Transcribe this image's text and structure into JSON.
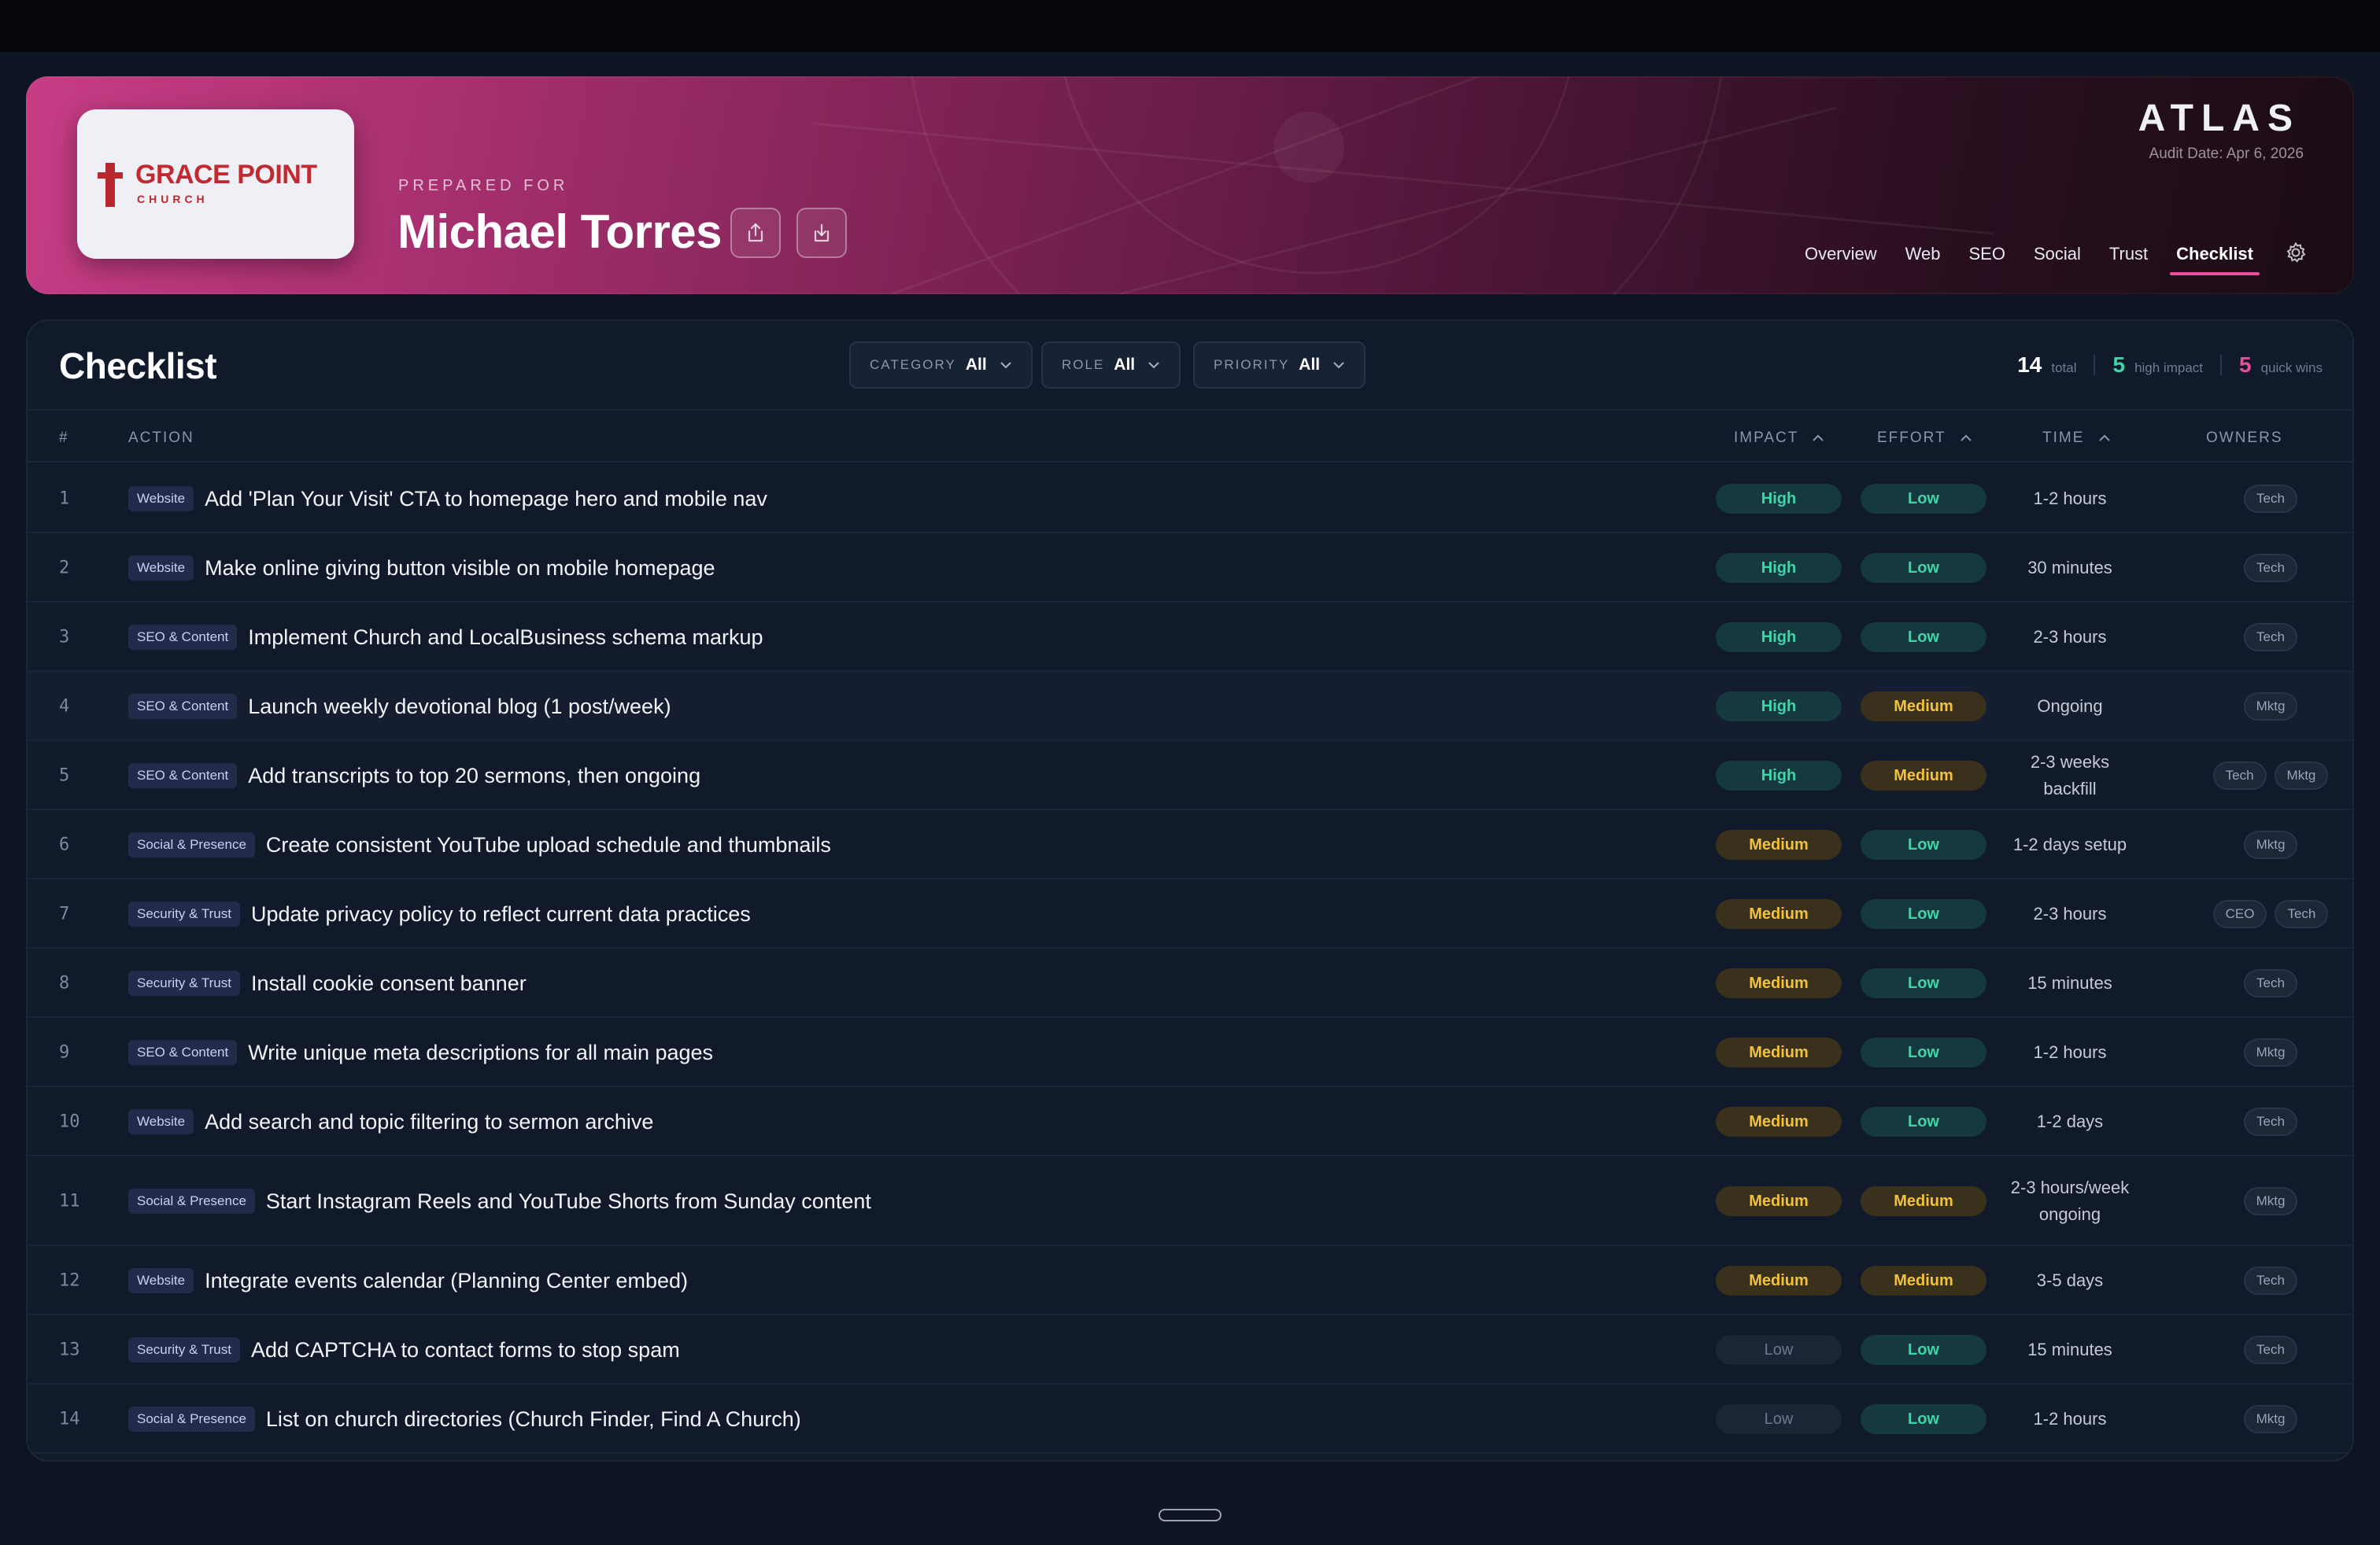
{
  "header": {
    "logo": {
      "name": "GRACE POINT",
      "sub": "CHURCH"
    },
    "prepared_label": "PREPARED FOR",
    "client_name": "Michael Torres",
    "brand": "ATLAS",
    "audit_date": "Audit Date: Apr 6, 2026",
    "nav": [
      "Overview",
      "Web",
      "SEO",
      "Social",
      "Trust",
      "Checklist"
    ],
    "active_tab": "Checklist"
  },
  "checklist": {
    "title": "Checklist",
    "filters": [
      {
        "label": "CATEGORY",
        "value": "All"
      },
      {
        "label": "ROLE",
        "value": "All"
      },
      {
        "label": "PRIORITY",
        "value": "All"
      }
    ],
    "stats": {
      "total": {
        "value": "14",
        "label": "total",
        "color": "#ffffff"
      },
      "high_impact": {
        "value": "5",
        "label": "high impact",
        "color": "#3ed6a7"
      },
      "quick_wins": {
        "value": "5",
        "label": "quick wins",
        "color": "#e94d9b"
      }
    },
    "columns": {
      "num": "#",
      "action": "ACTION",
      "impact": "IMPACT",
      "effort": "EFFORT",
      "time": "TIME",
      "owners": "OWNERS"
    },
    "rows": [
      {
        "num": "1",
        "category": "Website",
        "action": "Add 'Plan Your Visit' CTA to homepage hero and mobile nav",
        "impact": "High",
        "effort": "Low",
        "time": "1-2 hours",
        "owners": [
          "Tech"
        ]
      },
      {
        "num": "2",
        "category": "Website",
        "action": "Make online giving button visible on mobile homepage",
        "impact": "High",
        "effort": "Low",
        "time": "30 minutes",
        "owners": [
          "Tech"
        ]
      },
      {
        "num": "3",
        "category": "SEO & Content",
        "action": "Implement Church and LocalBusiness schema markup",
        "impact": "High",
        "effort": "Low",
        "time": "2-3 hours",
        "owners": [
          "Tech"
        ]
      },
      {
        "num": "4",
        "category": "SEO & Content",
        "action": "Launch weekly devotional blog (1 post/week)",
        "impact": "High",
        "effort": "Medium",
        "time": "Ongoing",
        "owners": [
          "Mktg"
        ]
      },
      {
        "num": "5",
        "category": "SEO & Content",
        "action": "Add transcripts to top 20 sermons, then ongoing",
        "impact": "High",
        "effort": "Medium",
        "time": "2-3 weeks backfill",
        "owners": [
          "Tech",
          "Mktg"
        ]
      },
      {
        "num": "6",
        "category": "Social & Presence",
        "action": "Create consistent YouTube upload schedule and thumbnails",
        "impact": "Medium",
        "effort": "Low",
        "time": "1-2 days setup",
        "owners": [
          "Mktg"
        ]
      },
      {
        "num": "7",
        "category": "Security & Trust",
        "action": "Update privacy policy to reflect current data practices",
        "impact": "Medium",
        "effort": "Low",
        "time": "2-3 hours",
        "owners": [
          "CEO",
          "Tech"
        ]
      },
      {
        "num": "8",
        "category": "Security & Trust",
        "action": "Install cookie consent banner",
        "impact": "Medium",
        "effort": "Low",
        "time": "15 minutes",
        "owners": [
          "Tech"
        ]
      },
      {
        "num": "9",
        "category": "SEO & Content",
        "action": "Write unique meta descriptions for all main pages",
        "impact": "Medium",
        "effort": "Low",
        "time": "1-2 hours",
        "owners": [
          "Mktg"
        ]
      },
      {
        "num": "10",
        "category": "Website",
        "action": "Add search and topic filtering to sermon archive",
        "impact": "Medium",
        "effort": "Low",
        "time": "1-2 days",
        "owners": [
          "Tech"
        ]
      },
      {
        "num": "11",
        "category": "Social & Presence",
        "action": "Start Instagram Reels and YouTube Shorts from Sunday content",
        "impact": "Medium",
        "effort": "Medium",
        "time": "2-3 hours/week ongoing",
        "owners": [
          "Mktg"
        ]
      },
      {
        "num": "12",
        "category": "Website",
        "action": "Integrate events calendar (Planning Center embed)",
        "impact": "Medium",
        "effort": "Medium",
        "time": "3-5 days",
        "owners": [
          "Tech"
        ]
      },
      {
        "num": "13",
        "category": "Security & Trust",
        "action": "Add CAPTCHA to contact forms to stop spam",
        "impact": "Low",
        "effort": "Low",
        "time": "15 minutes",
        "owners": [
          "Tech"
        ]
      },
      {
        "num": "14",
        "category": "Social & Presence",
        "action": "List on church directories (Church Finder, Find A Church)",
        "impact": "Low",
        "effort": "Low",
        "time": "1-2 hours",
        "owners": [
          "Mktg"
        ]
      }
    ]
  }
}
